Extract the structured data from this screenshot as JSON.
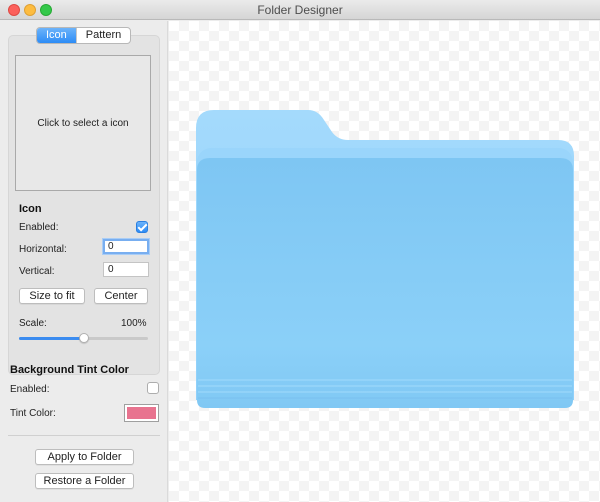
{
  "window": {
    "title": "Folder Designer"
  },
  "tabs": [
    {
      "label": "Icon",
      "selected": true
    },
    {
      "label": "Pattern",
      "selected": false
    }
  ],
  "icon_well": {
    "placeholder": "Click to select a icon"
  },
  "icon_section": {
    "title": "Icon",
    "enabled_label": "Enabled:",
    "enabled": true,
    "horizontal_label": "Horizontal:",
    "horizontal_value": "0",
    "vertical_label": "Vertical:",
    "vertical_value": "0",
    "size_to_fit_label": "Size to fit",
    "center_label": "Center",
    "scale_label": "Scale:",
    "scale_value": "100%",
    "scale_fraction": 0.5
  },
  "background_section": {
    "title": "Background Tint Color",
    "enabled_label": "Enabled:",
    "enabled": false,
    "tint_label": "Tint Color:",
    "tint_color": "#e8738f"
  },
  "actions": {
    "apply_label": "Apply to Folder",
    "restore_label": "Restore a Folder"
  },
  "preview": {
    "folder_color": "#7ec8f7",
    "accent": "#3b8cf0"
  }
}
